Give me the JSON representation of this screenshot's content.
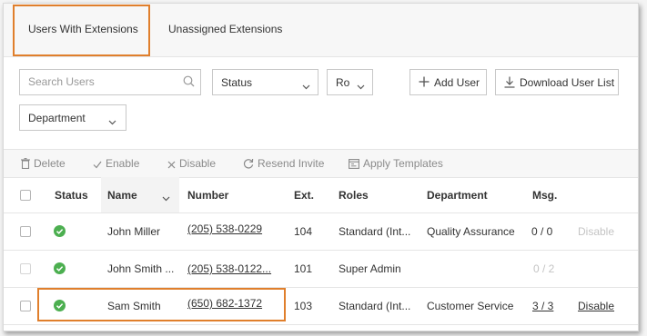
{
  "tabs": [
    {
      "label": "Users With Extensions",
      "active": true
    },
    {
      "label": "Unassigned Extensions",
      "active": false
    }
  ],
  "toolbar": {
    "search_placeholder": "Search Users",
    "status_filter": "Status",
    "roles_filter": "Ro",
    "add_user": "Add User",
    "download_list": "Download User List",
    "department_filter": "Department"
  },
  "actions": {
    "delete": "Delete",
    "enable": "Enable",
    "disable": "Disable",
    "resend_invite": "Resend Invite",
    "apply_templates": "Apply Templates"
  },
  "columns": {
    "status": "Status",
    "name": "Name",
    "number": "Number",
    "ext": "Ext.",
    "roles": "Roles",
    "department": "Department",
    "msg": "Msg."
  },
  "rows": [
    {
      "name": "John Miller",
      "number": "(205) 538-0229",
      "ext": "104",
      "roles": "Standard (Int...",
      "department": "Quality Assurance",
      "msg": "0 / 0",
      "action": "Disable",
      "msg_link": false,
      "action_link": false
    },
    {
      "name": "John Smith ...",
      "number": "(205) 538-0122...",
      "ext": "101",
      "roles": "Super Admin",
      "department": "",
      "msg": "0 / 2",
      "action": "",
      "msg_link": false,
      "action_link": false
    },
    {
      "name": "Sam Smith",
      "number": "(650) 682-1372",
      "ext": "103",
      "roles": "Standard (Int...",
      "department": "Customer Service",
      "msg": "3 / 3",
      "action": "Disable",
      "msg_link": true,
      "action_link": true
    }
  ],
  "colors": {
    "highlight": "#e07f2c",
    "status_ok": "#4caf50"
  }
}
